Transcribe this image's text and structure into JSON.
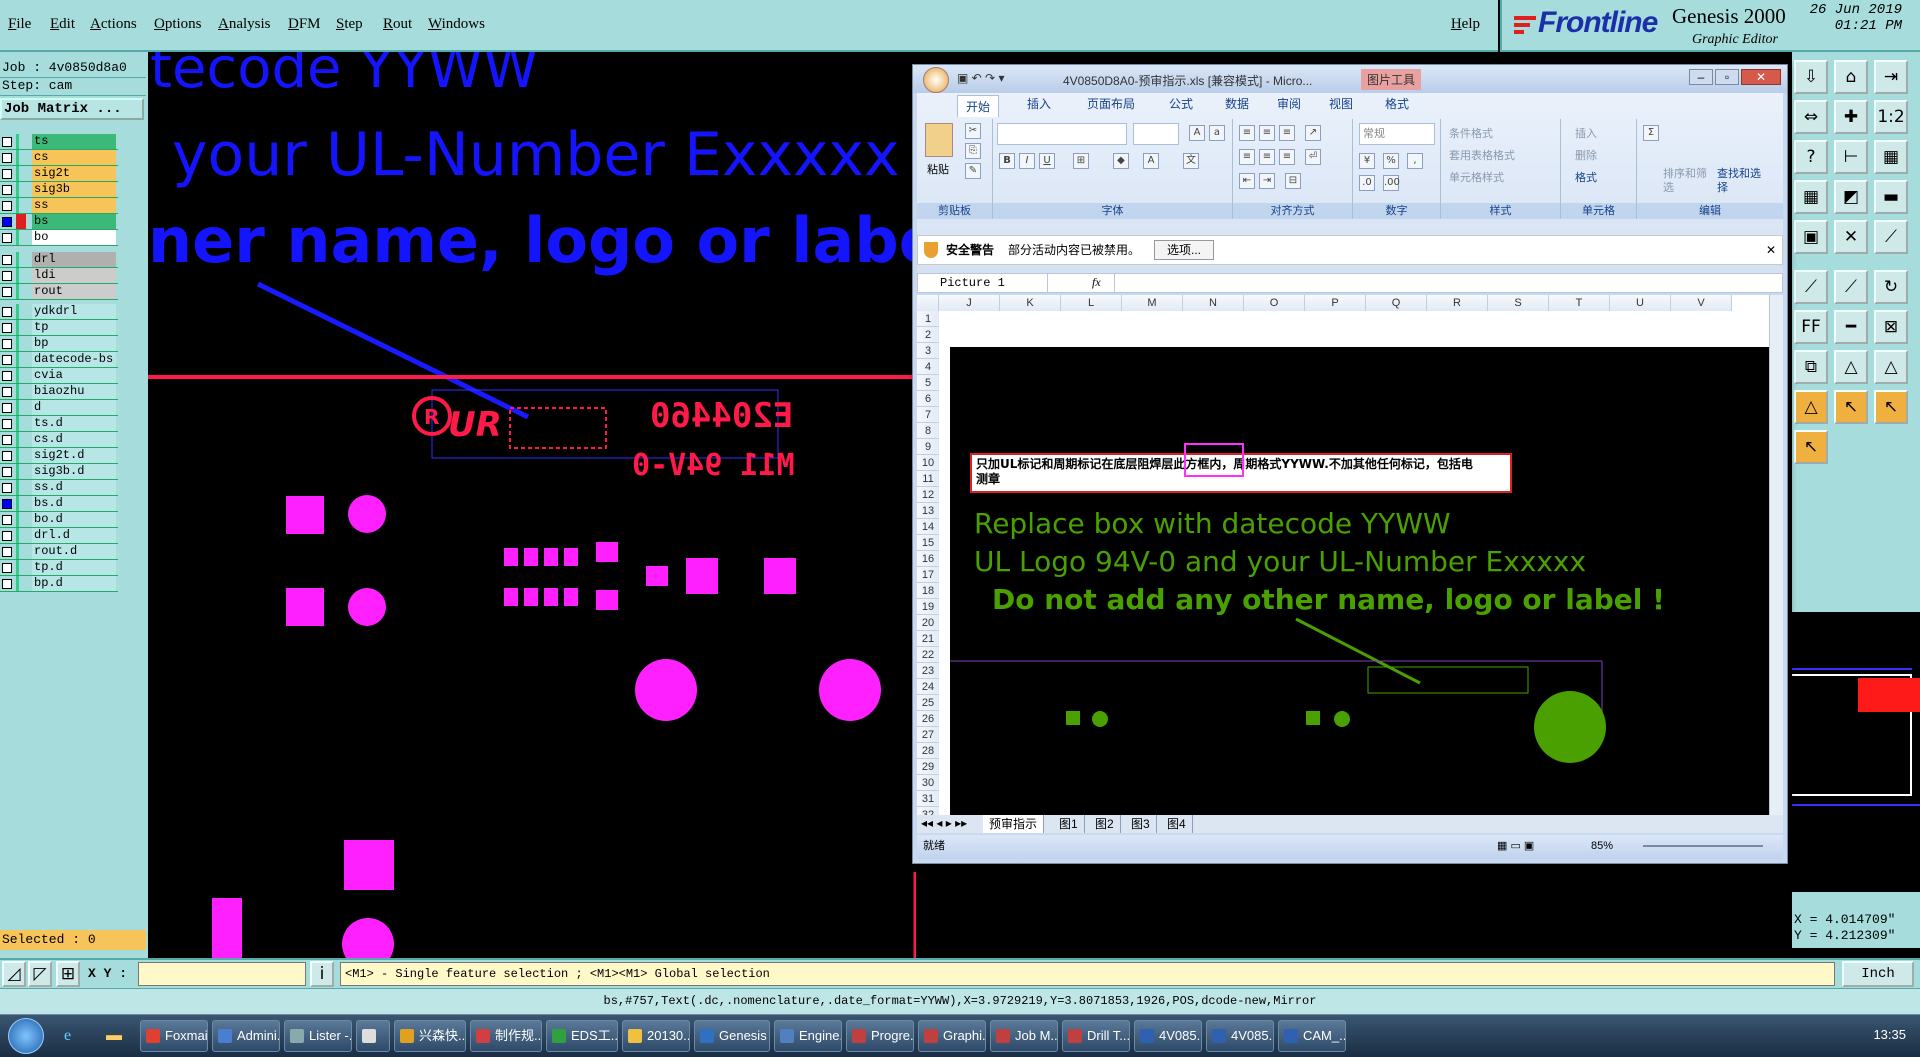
{
  "menubar": {
    "items": [
      "File",
      "Edit",
      "Actions",
      "Options",
      "Analysis",
      "DFM",
      "Step",
      "Rout",
      "Windows"
    ],
    "help": "Help"
  },
  "brand": {
    "name": "Frontline",
    "product": "Genesis 2000",
    "subtitle": "Graphic Editor",
    "date": "26 Jun 2019",
    "time": "01:21 PM"
  },
  "leftpanel": {
    "job": "Job : 4v0850d8a0",
    "step": "Step: cam",
    "job_matrix": "Job Matrix ...",
    "layers_group1": [
      "ts",
      "cs",
      "sig2t",
      "sig3b",
      "ss",
      "bs",
      "bo"
    ],
    "layers_group2": [
      "drl",
      "ldi",
      "rout"
    ],
    "layers_group3": [
      "ydkdrl",
      "tp",
      "bp",
      "datecode-bs",
      "cvia",
      "biaozhu",
      "d",
      "ts.d",
      "cs.d",
      "sig2t.d",
      "sig3b.d",
      "ss.d",
      "bs.d",
      "bo.d",
      "drl.d",
      "rout.d",
      "tp.d",
      "bp.d"
    ],
    "selected": "Selected : 0"
  },
  "canvas": {
    "line1": "tecode YYWW",
    "line2": "your UL-Number Exxxxx",
    "line3": "ner name, logo or label !",
    "ul_number": "E204460",
    "logo_text": "94V-0",
    "marking_prefix": "M11"
  },
  "coords": {
    "x": "X = 4.014709\"",
    "y": "Y = 4.212309\""
  },
  "cmdbar": {
    "xy_label": "X Y :",
    "message": "<M1> - Single feature selection ; <M1><M1> Global selection",
    "units": "Inch"
  },
  "statusline": "bs,#757,Text(.dc,.nomenclature,.date_format=YYWW),X=3.9729219,Y=3.8071853,1926,POS,dcode-new,Mirror",
  "excel": {
    "title": "4V0850D8A0-预审指示.xls [兼容模式] - Micro...",
    "title_extra": "图片工具",
    "tabs": [
      "开始",
      "插入",
      "页面布局",
      "公式",
      "数据",
      "审阅",
      "视图",
      "格式"
    ],
    "groups": [
      "剪贴板",
      "字体",
      "对齐方式",
      "数字",
      "样式",
      "单元格",
      "编辑"
    ],
    "paste": "粘贴",
    "number_format": "常规",
    "style_items": [
      "条件格式",
      "套用表格格式",
      "单元格样式"
    ],
    "cell_items": [
      "插入",
      "删除",
      "格式"
    ],
    "edit_items": [
      "排序和筛选",
      "查找和选择"
    ],
    "security_label": "安全警告",
    "security_text": "部分活动内容已被禁用。",
    "security_button": "选项...",
    "namebox": "Picture 1",
    "fx": "fx",
    "columns": [
      "J",
      "K",
      "L",
      "M",
      "N",
      "O",
      "P",
      "Q",
      "R",
      "S",
      "T",
      "U",
      "V"
    ],
    "rows": [
      "1",
      "2",
      "3",
      "4",
      "5",
      "6",
      "7",
      "8",
      "9",
      "10",
      "11",
      "12",
      "13",
      "14",
      "15",
      "16",
      "17",
      "18",
      "19",
      "20",
      "21",
      "22",
      "23",
      "24",
      "25",
      "26",
      "27",
      "28",
      "29",
      "30",
      "31",
      "32"
    ],
    "note_line1": "只加UL标记和周期标记在底层阻焊层此方框内，周期格式YYWW.不加其他任何标记，包括电",
    "note_line2": "测章",
    "green1": "Replace box with datecode YYWW",
    "green2": "UL Logo 94V-0 and your UL-Number Exxxxx",
    "green3": "Do not add any other name, logo or label !",
    "sheet_tabs": [
      "预审指示",
      "图1",
      "图2",
      "图3",
      "图4"
    ],
    "status": "就绪",
    "zoom": "85%"
  },
  "taskbar": {
    "tasks": [
      "Foxmail",
      "Admini...",
      "Lister -...",
      "",
      "兴森快...",
      "制作规...",
      "EDS工...",
      "20130...",
      "Genesis",
      "Engine...",
      "Progre...",
      "Graphi...",
      "Job M...",
      "Drill T...",
      "4V085...",
      "4V085...",
      "CAM_..."
    ],
    "clock": "13:35"
  }
}
